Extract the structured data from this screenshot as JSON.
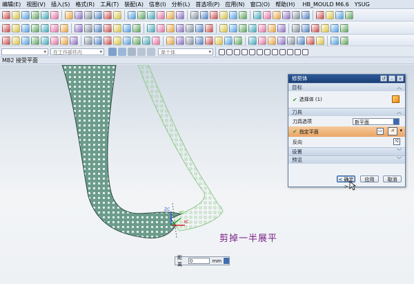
{
  "menubar": {
    "items": [
      "编辑(E)",
      "视图(V)",
      "插入(S)",
      "格式(R)",
      "工具(T)",
      "装配(A)",
      "信息(I)",
      "分析(L)",
      "首选项(P)",
      "应用(N)",
      "窗口(O)",
      "帮助(H)"
    ],
    "brand": "HB_MOULD M6.6",
    "brand2": "YSUG"
  },
  "selection_bar": {
    "filter_placeholder": "在工作部件内",
    "snap_placeholder": "单个体"
  },
  "graphics_title": "MB2 接受平面",
  "viewport": {
    "caption": "剪掉一半展平",
    "distance_label": "距离",
    "distance_value": "0",
    "distance_unit": "mm",
    "axis_labels": {
      "zc": "ZC",
      "yc": "YC",
      "xc": "XC"
    }
  },
  "dialog": {
    "title": "修剪体",
    "target_section": "目标",
    "select_body": "选择体 (1)",
    "tool_section": "刀具",
    "tool_option_label": "刀具选项",
    "tool_option_value": "新平面",
    "specify_plane": "指定平面",
    "reverse_label": "反向",
    "settings_section": "设置",
    "preview_section": "预览",
    "ok_button": "< 确定 >",
    "apply_button": "应用",
    "cancel_button": "取消"
  },
  "colors": {
    "surface": "#6d9c8c",
    "surface_preview": "#9fd29a",
    "dialog_title": "#2b5797",
    "highlight_row": "#f0b47d",
    "caption": "#7a1f8a"
  }
}
